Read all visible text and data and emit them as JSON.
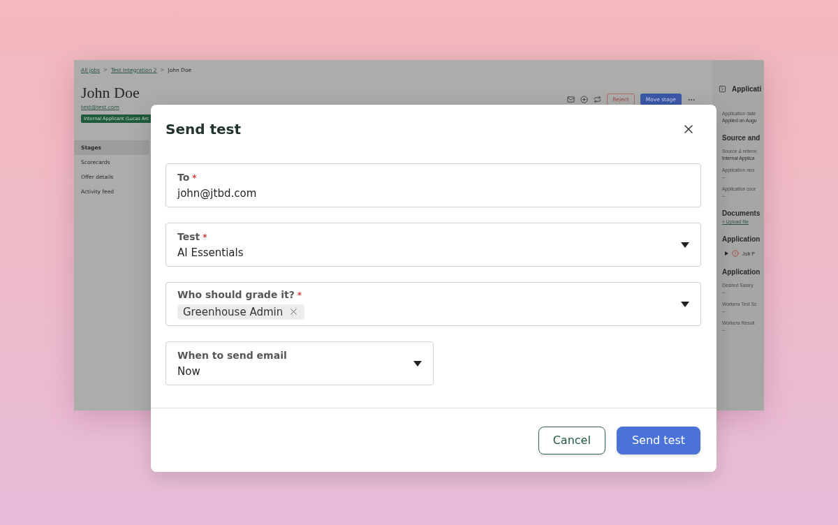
{
  "app": {
    "breadcrumb": [
      {
        "label": "All jobs",
        "link": true
      },
      {
        "label": "Test Integration 2",
        "link": true
      },
      {
        "label": "John Doe",
        "link": false
      }
    ],
    "breadcrumb_separator": ">",
    "candidate": {
      "name": "John Doe",
      "email": "test@test.com",
      "badge": "Internal Applicant (Lucas Arc"
    },
    "toolbar": {
      "reject": "Reject",
      "move_stage": "Move stage"
    },
    "nav": [
      {
        "label": "Stages",
        "selected": true
      },
      {
        "label": "Scorecards",
        "selected": false
      },
      {
        "label": "Offer details",
        "selected": false
      },
      {
        "label": "Activity feed",
        "selected": false
      }
    ],
    "side_panel": {
      "title": "Applicati",
      "rows": [
        {
          "kind": "label",
          "text": "Application date"
        },
        {
          "kind": "value",
          "text": "Applied on Augu"
        },
        {
          "kind": "heading",
          "text": "Source and"
        },
        {
          "kind": "label",
          "text": "Source & referre"
        },
        {
          "kind": "value",
          "text": "Internal Applica"
        },
        {
          "kind": "label",
          "text": "Application recr"
        },
        {
          "kind": "value",
          "text": "--"
        },
        {
          "kind": "label",
          "text": "Application coor"
        },
        {
          "kind": "value",
          "text": "--"
        },
        {
          "kind": "heading",
          "text": "Documents"
        },
        {
          "kind": "link",
          "text": "+ Upload file"
        },
        {
          "kind": "heading",
          "text": "Application"
        },
        {
          "kind": "attachment",
          "text": "Job P"
        },
        {
          "kind": "heading",
          "text": "Application"
        },
        {
          "kind": "label",
          "text": "Desired Salary"
        },
        {
          "kind": "value",
          "text": "--"
        },
        {
          "kind": "label",
          "text": "Workera Test Sc"
        },
        {
          "kind": "value",
          "text": "--"
        },
        {
          "kind": "label",
          "text": "Workera Result"
        },
        {
          "kind": "value",
          "text": "--"
        }
      ]
    }
  },
  "dialog": {
    "title": "Send test",
    "fields": [
      {
        "kind": "text",
        "label": "To",
        "required_mark": "*",
        "value": "john@jtbd.com"
      },
      {
        "kind": "select",
        "label": "Test",
        "required_mark": "*",
        "value": "AI Essentials"
      },
      {
        "kind": "multiselect",
        "label": "Who should grade it?",
        "required_mark": "*",
        "chips": [
          "Greenhouse Admin"
        ]
      },
      {
        "kind": "short-select",
        "label": "When to send email",
        "value": "Now"
      }
    ],
    "buttons": [
      {
        "kind": "secondary",
        "label": "Cancel"
      },
      {
        "kind": "primary",
        "label": "Send test"
      }
    ]
  }
}
